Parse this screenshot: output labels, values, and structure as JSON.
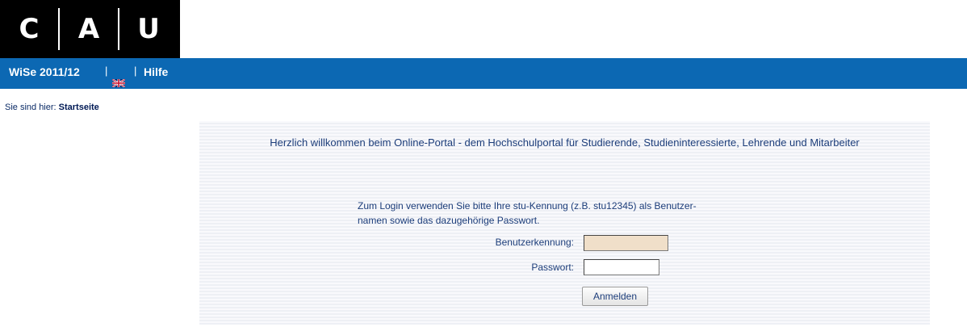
{
  "logo": {
    "letters": [
      "C",
      "A",
      "U"
    ]
  },
  "nav": {
    "semester": "WiSe 2011/12",
    "separator": "|",
    "help": "Hilfe",
    "flag_icon": "uk-flag-icon"
  },
  "breadcrumb": {
    "prefix": "Sie sind hier:",
    "current": "Startseite"
  },
  "main": {
    "welcome": "Herzlich willkommen beim Online-Portal - dem Hochschulportal für Studierende, Studieninteressierte, Lehrende und Mitarbeiter",
    "login_note_line1": "Zum Login verwenden Sie bitte Ihre stu-Kennung (z.B. stu12345) als Benutzer-",
    "login_note_line2": "namen sowie das dazugehörige Passwort.",
    "username_label": "Benutzerkennung:",
    "username_value": "",
    "password_label": "Passwort:",
    "password_value": "",
    "login_button": "Anmelden"
  },
  "colors": {
    "navbar": "#0c68b3",
    "logo_bg": "#000000",
    "username_field_bg": "#f0dfc9",
    "text": "#1c3d7a"
  }
}
